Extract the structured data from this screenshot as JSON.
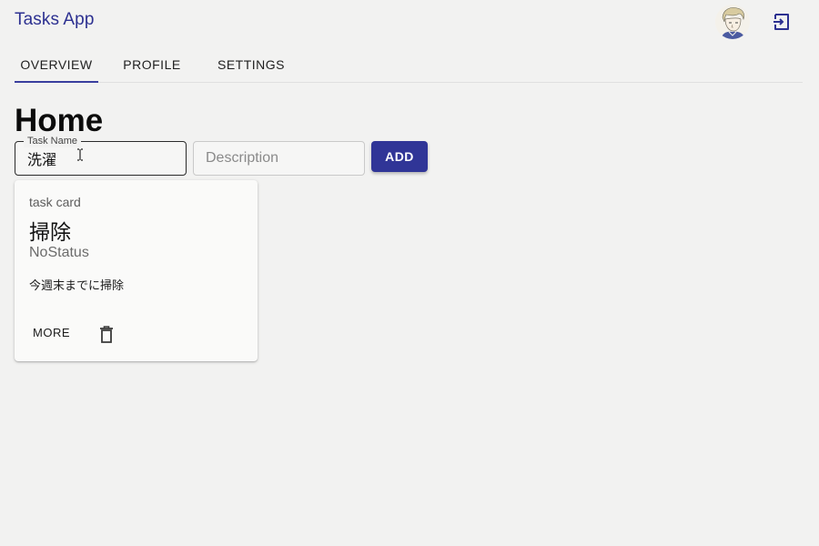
{
  "app": {
    "title": "Tasks App"
  },
  "tabs": [
    {
      "label": "OVERVIEW",
      "active": true
    },
    {
      "label": "PROFILE",
      "active": false
    },
    {
      "label": "SETTINGS",
      "active": false
    }
  ],
  "page": {
    "title": "Home"
  },
  "form": {
    "task_name": {
      "label": "Task Name",
      "value": "洗濯"
    },
    "description": {
      "placeholder": "Description"
    },
    "add_label": "ADD"
  },
  "task_card": {
    "overline": "task card",
    "title": "掃除",
    "status": "NoStatus",
    "description": "今週末までに掃除",
    "more_label": "MORE"
  },
  "icons": {
    "logout": "logout-icon",
    "delete": "trash-icon",
    "avatar": "user-avatar"
  },
  "colors": {
    "primary": "#303597",
    "title": "#2d3191",
    "background": "#f2f2f1"
  }
}
